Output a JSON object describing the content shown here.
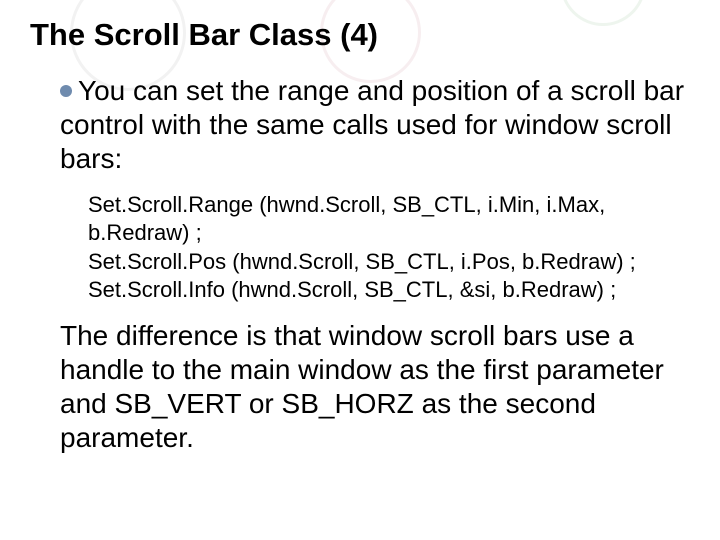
{
  "title": "The Scroll Bar Class  (4)",
  "lead_prefix": "You",
  "lead_rest": " can set the range and position of a scroll bar control with the same calls used for window scroll bars:",
  "code_lines": [
    "Set.Scroll.Range (hwnd.Scroll, SB_CTL, i.Min, i.Max, b.Redraw) ;",
    "Set.Scroll.Pos (hwnd.Scroll, SB_CTL, i.Pos, b.Redraw) ;",
    "Set.Scroll.Info (hwnd.Scroll, SB_CTL, &si, b.Redraw) ;"
  ],
  "trail": "The difference is that window scroll bars use a handle to the main window as the first parameter and SB_VERT or SB_HORZ as the second parameter."
}
